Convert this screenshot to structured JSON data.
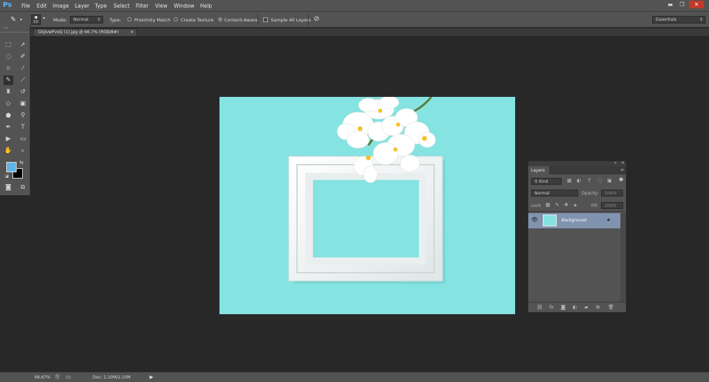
{
  "app": {
    "logo": "Ps"
  },
  "menu": [
    "File",
    "Edit",
    "Image",
    "Layer",
    "Type",
    "Select",
    "Filter",
    "View",
    "Window",
    "Help"
  ],
  "window_controls": {
    "minimize": "▬",
    "maximize": "❐",
    "close": "✕"
  },
  "options": {
    "brush_size": "10",
    "mode_label": "Mode:",
    "mode_value": "Normal",
    "type_label": "Type:",
    "types": [
      "Proximity Match",
      "Create Texture",
      "Content-Aware"
    ],
    "selected_type": "Content-Aware",
    "sample_all_layers": "Sample All Layers",
    "workspace": "Essentials"
  },
  "document_tab": {
    "title": "GkjlvwPvoQ (1).jpg @ 66.7% (RGB/8#)",
    "close": "×"
  },
  "colors": {
    "foreground": "#5db4e6",
    "background": "#000000",
    "canvas_bg": "#85e3e2",
    "accent": "#5db7f4"
  },
  "layers_panel": {
    "title": "Layers",
    "kind_label": "Kind",
    "blend_mode": "Normal",
    "opacity_label": "Opacity:",
    "opacity_value": "100%",
    "lock_label": "Lock:",
    "fill_label": "Fill:",
    "fill_value": "100%",
    "layer_name": "Background"
  },
  "status": {
    "zoom": "66.67%",
    "doc_info": "Doc: 2.10M/2.10M"
  }
}
